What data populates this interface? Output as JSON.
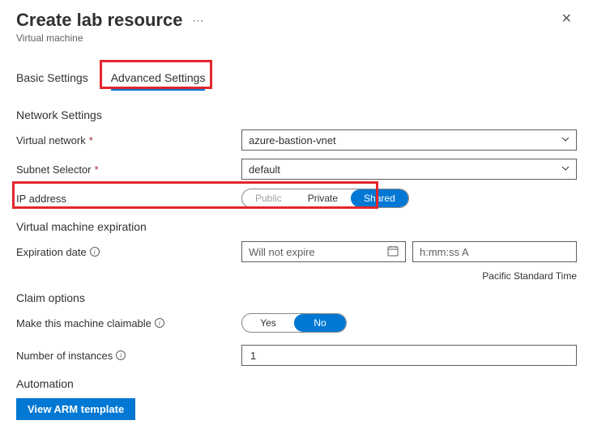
{
  "header": {
    "title": "Create lab resource",
    "subtitle": "Virtual machine"
  },
  "tabs": {
    "basic": "Basic Settings",
    "advanced": "Advanced Settings"
  },
  "sections": {
    "network": "Network Settings",
    "expiration": "Virtual machine expiration",
    "claim": "Claim options",
    "automation": "Automation"
  },
  "labels": {
    "vnet": "Virtual network",
    "subnet": "Subnet Selector",
    "ip": "IP address",
    "expiration_date": "Expiration date",
    "claimable": "Make this machine claimable",
    "instances": "Number of instances"
  },
  "values": {
    "vnet": "azure-bastion-vnet",
    "subnet": "default",
    "expiration_placeholder": "Will not expire",
    "time_placeholder": "h:mm:ss A",
    "timezone": "Pacific Standard Time",
    "instances": "1"
  },
  "ip_options": {
    "public": "Public",
    "private": "Private",
    "shared": "Shared"
  },
  "yes_no": {
    "yes": "Yes",
    "no": "No"
  },
  "buttons": {
    "view_arm": "View ARM template"
  }
}
